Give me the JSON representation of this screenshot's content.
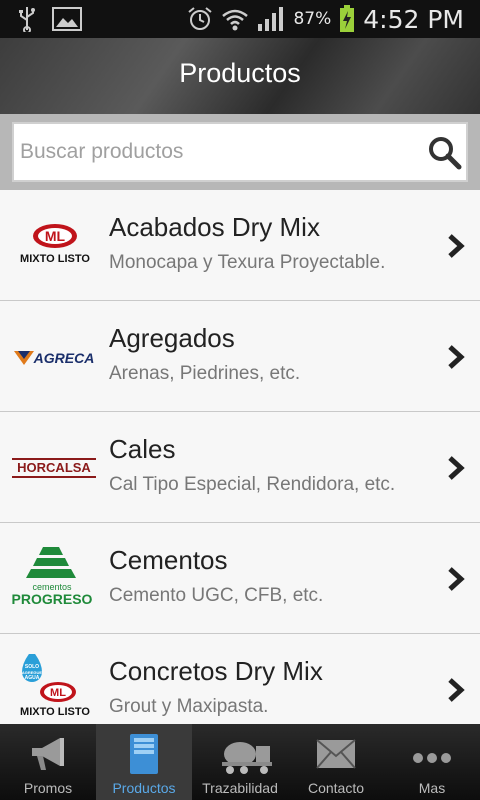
{
  "status_bar": {
    "battery_percent": "87%",
    "time": "4:52 PM"
  },
  "header": {
    "title": "Productos"
  },
  "search": {
    "placeholder": "Buscar productos",
    "value": ""
  },
  "products": [
    {
      "title": "Acabados Dry Mix",
      "subtitle": "Monocapa y Texura Proyectable.",
      "logo_text": "MIXTO LISTO",
      "logo_badge": "ML"
    },
    {
      "title": "Agregados",
      "subtitle": "Arenas, Piedrines, etc.",
      "logo_text": "AGRECA"
    },
    {
      "title": "Cales",
      "subtitle": "Cal Tipo Especial, Rendidora, etc.",
      "logo_text": "HORCALSA"
    },
    {
      "title": "Cementos",
      "subtitle": "Cemento UGC, CFB, etc.",
      "logo_text": "PROGRESO",
      "logo_small": "cementos"
    },
    {
      "title": "Concretos Dry Mix",
      "subtitle": "Grout y Maxipasta.",
      "logo_text": "MIXTO LISTO",
      "logo_badge": "ML",
      "logo_drop": "SOLO AGREGUE AGUA"
    }
  ],
  "tabs": [
    {
      "label": "Promos"
    },
    {
      "label": "Productos"
    },
    {
      "label": "Trazabilidad"
    },
    {
      "label": "Contacto"
    },
    {
      "label": "Mas"
    }
  ],
  "colors": {
    "active_tab": "#5aa9e8",
    "brand_red": "#c0141b",
    "brand_green": "#1f8a3a"
  }
}
